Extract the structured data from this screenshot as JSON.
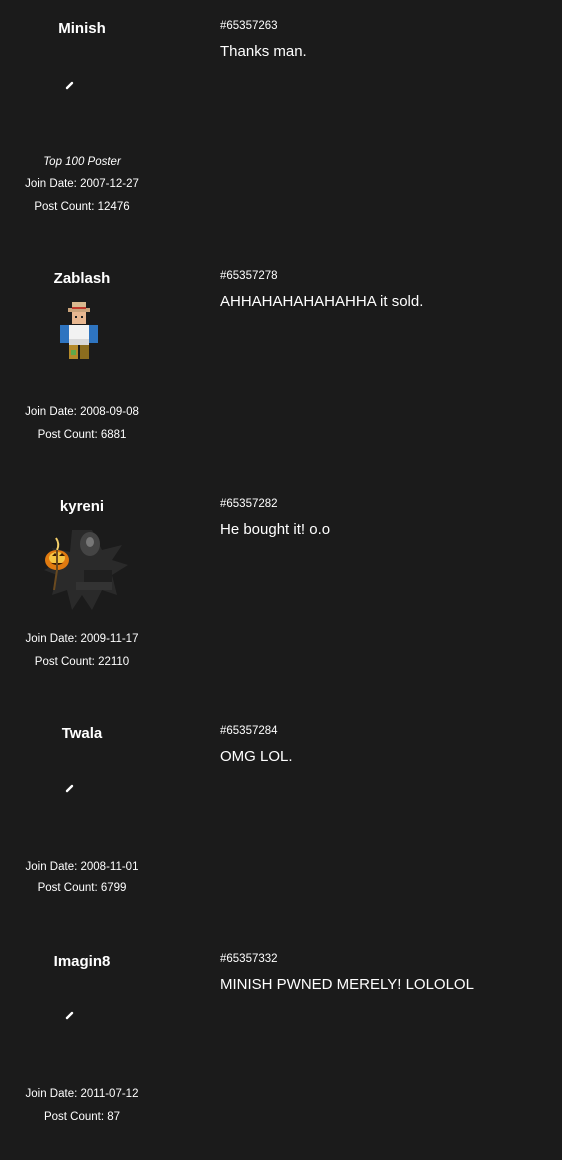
{
  "posts": [
    {
      "username": "Minish",
      "avatar": "broken-image-icon",
      "title": "Top 100 Poster",
      "join_date": "Join Date: 2007-12-27",
      "post_count": "Post Count: 12476",
      "post_id": "#65357263",
      "body": "Thanks man."
    },
    {
      "username": "Zablash",
      "avatar": "roblox-avatar-cowboy",
      "title": "",
      "join_date": "Join Date: 2008-09-08",
      "post_count": "Post Count: 6881",
      "post_id": "#65357278",
      "body": "AHHAHAHAHAHAHHA it sold."
    },
    {
      "username": "kyreni",
      "avatar": "pumpkin-reaper-avatar",
      "title": "",
      "join_date": "Join Date: 2009-11-17",
      "post_count": "Post Count: 22110",
      "post_id": "#65357282",
      "body": "He bought it! o.o"
    },
    {
      "username": "Twala",
      "avatar": "broken-image-icon",
      "title": "",
      "join_date": "Join Date: 2008-11-01",
      "post_count": "Post Count: 6799",
      "post_id": "#65357284",
      "body": "OMG LOL."
    },
    {
      "username": "Imagin8",
      "avatar": "broken-image-icon",
      "title": "",
      "join_date": "Join Date: 2011-07-12",
      "post_count": "Post Count: 87",
      "post_id": "#65357332",
      "body": "MINISH PWNED MERELY! LOLOLOL"
    }
  ]
}
